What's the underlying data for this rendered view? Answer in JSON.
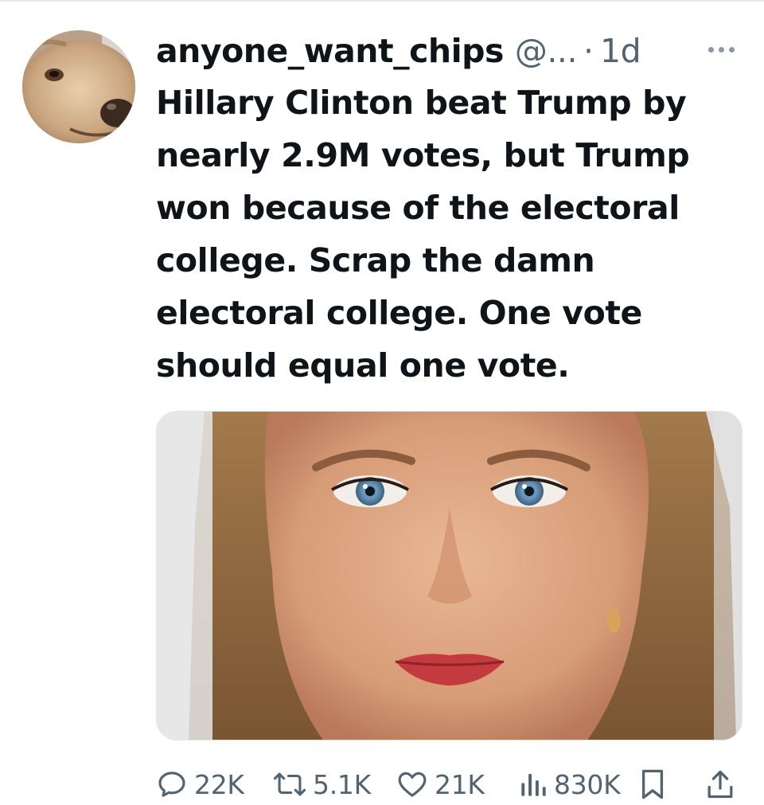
{
  "tweet": {
    "display_name": "anyone_want_chips",
    "handle": "@...",
    "separator": "·",
    "time": "1d",
    "text_lines": [
      "Hillary Clinton beat Trump by",
      "nearly 2.9M votes, but Trump",
      "won because of the electoral",
      "college. Scrap the damn",
      "electoral college. One vote",
      "should equal one vote."
    ]
  },
  "actions": {
    "replies": "22K",
    "reposts": "5.1K",
    "likes": "21K",
    "views": "830K"
  },
  "icons": {
    "more": "more-horizontal-icon",
    "reply": "reply-icon",
    "repost": "repost-icon",
    "like": "heart-icon",
    "views": "analytics-icon",
    "bookmark": "bookmark-icon",
    "share": "share-icon"
  },
  "colors": {
    "text": "#0f1419",
    "secondary": "#536471",
    "background": "#ffffff"
  }
}
